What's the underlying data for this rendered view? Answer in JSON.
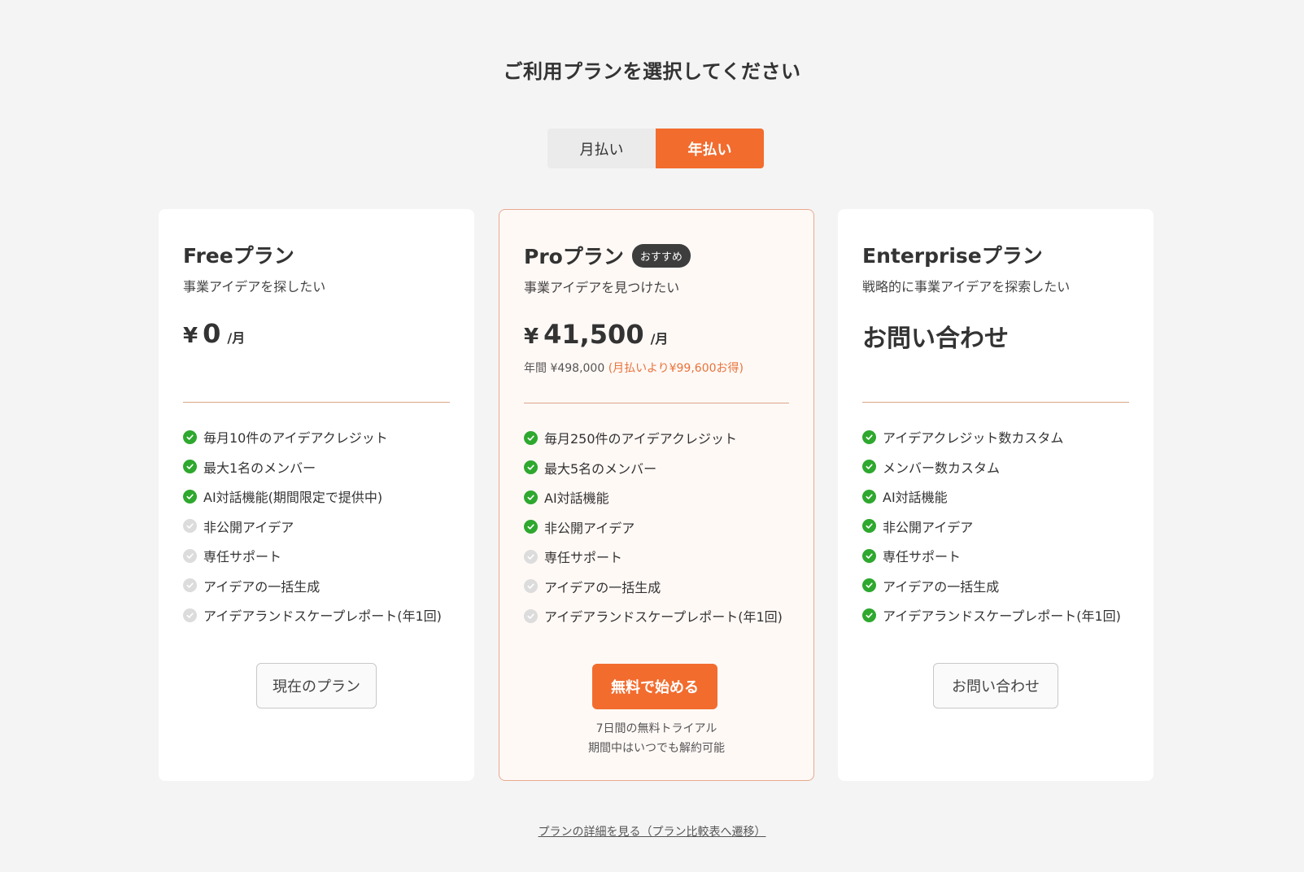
{
  "page": {
    "title": "ご利用プランを選択してください"
  },
  "billing_toggle": {
    "monthly_label": "月払い",
    "yearly_label": "年払い",
    "selected": "yearly"
  },
  "colors": {
    "accent": "#f26c2e",
    "check_on": "#2ea82e",
    "check_off": "#dcdcdc",
    "badge": "#3d3d3d"
  },
  "plans": [
    {
      "name": "Freeプラン",
      "subtitle": "事業アイデアを探したい",
      "price_currency": "¥",
      "price_amount": "0",
      "price_unit": "/月",
      "features": [
        {
          "label": "毎月10件のアイデアクレジット",
          "included": true
        },
        {
          "label": "最大1名のメンバー",
          "included": true
        },
        {
          "label": "AI対話機能(期間限定で提供中)",
          "included": true
        },
        {
          "label": "非公開アイデア",
          "included": false
        },
        {
          "label": "専任サポート",
          "included": false
        },
        {
          "label": "アイデアの一括生成",
          "included": false
        },
        {
          "label": "アイデアランドスケープレポート(年1回)",
          "included": false
        }
      ],
      "button_label": "現在のプラン"
    },
    {
      "name": "Proプラン",
      "badge": "おすすめ",
      "subtitle": "事業アイデアを見つけたい",
      "price_currency": "¥",
      "price_amount": "41,500",
      "price_unit": "/月",
      "annual_text": "年間 ¥498,000",
      "annual_saving": "(月払いより¥99,600お得)",
      "features": [
        {
          "label": "毎月250件のアイデアクレジット",
          "included": true
        },
        {
          "label": "最大5名のメンバー",
          "included": true
        },
        {
          "label": "AI対話機能",
          "included": true
        },
        {
          "label": "非公開アイデア",
          "included": true
        },
        {
          "label": "専任サポート",
          "included": false
        },
        {
          "label": "アイデアの一括生成",
          "included": false
        },
        {
          "label": "アイデアランドスケープレポート(年1回)",
          "included": false
        }
      ],
      "button_label": "無料で始める",
      "trial_line1": "7日間の無料トライアル",
      "trial_line2": "期間中はいつでも解約可能"
    },
    {
      "name": "Enterpriseプラン",
      "subtitle": "戦略的に事業アイデアを探索したい",
      "price_text": "お問い合わせ",
      "features": [
        {
          "label": "アイデアクレジット数カスタム",
          "included": true
        },
        {
          "label": "メンバー数カスタム",
          "included": true
        },
        {
          "label": "AI対話機能",
          "included": true
        },
        {
          "label": "非公開アイデア",
          "included": true
        },
        {
          "label": "専任サポート",
          "included": true
        },
        {
          "label": "アイデアの一括生成",
          "included": true
        },
        {
          "label": "アイデアランドスケープレポート(年1回)",
          "included": true
        }
      ],
      "button_label": "お問い合わせ"
    }
  ],
  "footer": {
    "link_label": "プランの詳細を見る（プラン比較表へ遷移）"
  }
}
